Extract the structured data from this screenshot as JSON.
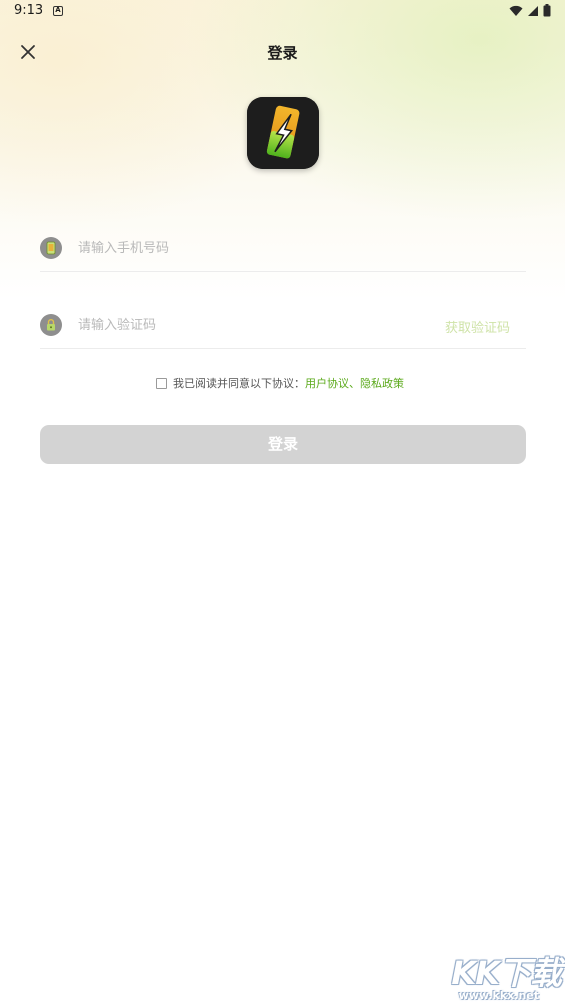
{
  "status_bar": {
    "time": "9:13",
    "notification_icon": "a-notification-icon",
    "right_icons": [
      "wifi-icon",
      "cellular-signal-icon",
      "battery-icon"
    ]
  },
  "nav": {
    "title": "登录",
    "close_icon": "close-icon"
  },
  "logo": {
    "icon": "phone-lightning-logo-icon"
  },
  "phone_field": {
    "placeholder": "请输入手机号码",
    "value": "",
    "icon": "phone-icon"
  },
  "code_field": {
    "placeholder": "请输入验证码",
    "value": "",
    "icon": "lock-icon",
    "get_code_label": "获取验证码"
  },
  "agreement": {
    "checked": false,
    "prefix": "我已阅读并同意以下协议：",
    "user_agreement": "用户协议",
    "separator": "、",
    "privacy_policy": "隐私政策"
  },
  "login_button": {
    "label": "登录"
  },
  "watermark": {
    "brand": "KK下载",
    "url": "www.kkx.net"
  },
  "colors": {
    "accent_green": "#5aa91a",
    "disabled_button": "#d3d3d3",
    "get_code_disabled": "#cfe3a8"
  }
}
